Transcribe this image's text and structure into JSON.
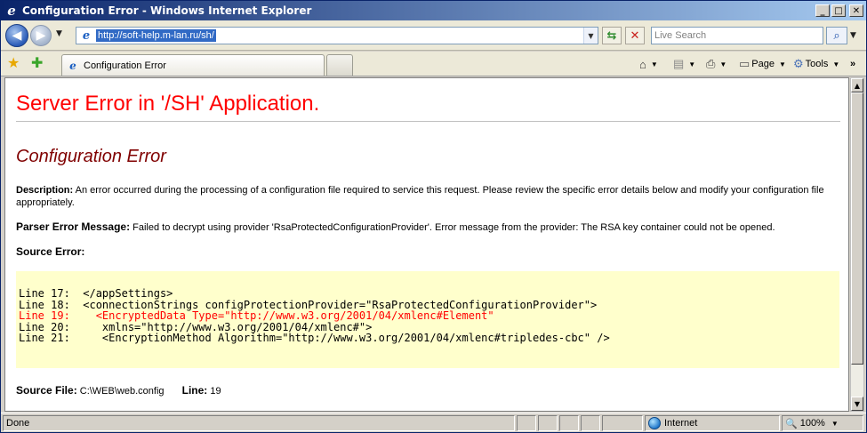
{
  "window": {
    "title": "Configuration Error - Windows Internet Explorer",
    "min_label": "_",
    "max_label": "□",
    "close_label": "✕"
  },
  "toolbar": {
    "back_label": "◀",
    "forward_label": "▶",
    "nav_dropdown": "▼",
    "address": "http://soft-help.m-lan.ru/sh/",
    "address_dropdown": "▼",
    "refresh_label": "⇆",
    "stop_label": "✕",
    "search_placeholder": "Live Search",
    "search_button": "⌕",
    "search_dropdown": "▼"
  },
  "tabs": {
    "favorites_icon": "star-icon",
    "add_favorites_icon": "add-favorites-icon",
    "active_tab_label": "Configuration Error"
  },
  "commands": {
    "home_glyph": "⌂",
    "feeds_glyph": "▤",
    "print_glyph": "⎙",
    "page_glyph": "▭",
    "page_label": "Page",
    "tools_glyph": "⚙",
    "tools_label": "Tools",
    "dropdown": "▼",
    "chevron": "»"
  },
  "page": {
    "heading": "Server Error in '/SH' Application.",
    "subheading": "Configuration Error",
    "description_label": "Description:",
    "description_text": " An error occurred during the processing of a configuration file required to service this request. Please review the specific error details below and modify your configuration file appropriately.",
    "parser_label": "Parser Error Message:",
    "parser_text": " Failed to decrypt using provider 'RsaProtectedConfigurationProvider'. Error message from the provider: The RSA key container could not be opened.",
    "source_error_label": "Source Error:",
    "code_lines": [
      "Line 17:  </appSettings>",
      "Line 18:  <connectionStrings configProtectionProvider=\"RsaProtectedConfigurationProvider\">",
      "Line 19:    <EncryptedData Type=\"http://www.w3.org/2001/04/xmlenc#Element\"",
      "Line 20:     xmlns=\"http://www.w3.org/2001/04/xmlenc#\">",
      "Line 21:     <EncryptionMethod Algorithm=\"http://www.w3.org/2001/04/xmlenc#tripledes-cbc\" />"
    ],
    "source_file_label": "Source File:",
    "source_file_value": " C:\\WEB\\web.config",
    "line_label": "Line:",
    "line_value": " 19"
  },
  "colors": {
    "heading": "#ff0000",
    "subheading": "#800000",
    "code_background": "#ffffcc",
    "highlight_line": "#ff0000"
  },
  "scrollbar": {
    "up_arrow": "▲",
    "down_arrow": "▼"
  },
  "status": {
    "text": "Done",
    "zone": "Internet",
    "zoom": "100%",
    "zoom_icon": "🔍",
    "zoom_dropdown": "▼"
  }
}
